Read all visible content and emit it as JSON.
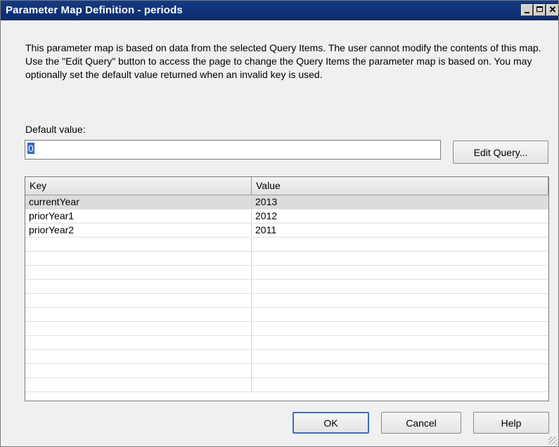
{
  "window": {
    "title": "Parameter Map Definition - periods"
  },
  "description": "This parameter map is based on data from the selected Query Items.  The user cannot modify the contents of this map.  Use the \"Edit Query\" button to access the page to change the Query Items the parameter map is based on.  You may optionally set the default value returned when an invalid key is used.",
  "default_value": {
    "label": "Default value:",
    "value": "0"
  },
  "buttons": {
    "edit_query": "Edit Query...",
    "ok": "OK",
    "cancel": "Cancel",
    "help": "Help"
  },
  "table": {
    "columns": [
      "Key",
      "Value"
    ],
    "rows": [
      {
        "key": "currentYear",
        "value": "2013",
        "selected": true
      },
      {
        "key": "priorYear1",
        "value": "2012"
      },
      {
        "key": "priorYear2",
        "value": "2011"
      }
    ],
    "empty_rows": 11
  },
  "colors": {
    "title_bar": "#163b82",
    "selection": "#3166c6",
    "row_selected": "#dcdcdc"
  }
}
